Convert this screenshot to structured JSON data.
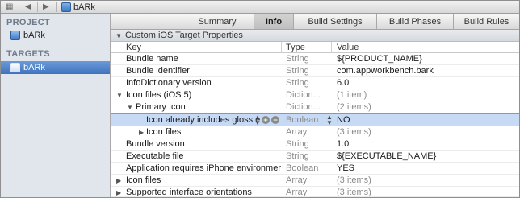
{
  "jumpbar": {
    "grid_icon": "grid-icon",
    "back_icon": "back-arrow-icon",
    "forward_icon": "forward-arrow-icon",
    "project_title": "bARk"
  },
  "sidebar": {
    "project_header": "PROJECT",
    "project_item": "bARk",
    "targets_header": "TARGETS",
    "target_item": "bARk"
  },
  "tabs": [
    "Summary",
    "Info",
    "Build Settings",
    "Build Phases",
    "Build Rules"
  ],
  "active_tab": "Info",
  "section": {
    "title": "Custom iOS Target Properties"
  },
  "table": {
    "headers": {
      "key": "Key",
      "type": "Type",
      "value": "Value"
    },
    "rows": [
      {
        "key": "Bundle name",
        "type": "String",
        "value": "${PRODUCT_NAME}"
      },
      {
        "key": "Bundle identifier",
        "type": "String",
        "value": "com.appworkbench.bark"
      },
      {
        "key": "InfoDictionary version",
        "type": "String",
        "value": "6.0"
      },
      {
        "key": "Icon files (iOS 5)",
        "type": "Diction...",
        "value": "(1 item)"
      },
      {
        "key": "Primary Icon",
        "type": "Diction...",
        "value": "(2 items)"
      },
      {
        "key": "Icon already includes gloss e",
        "type": "Boolean",
        "value": "NO"
      },
      {
        "key": "Icon files",
        "type": "Array",
        "value": "(3 items)"
      },
      {
        "key": "Bundle version",
        "type": "String",
        "value": "1.0"
      },
      {
        "key": "Executable file",
        "type": "String",
        "value": "${EXECUTABLE_NAME}"
      },
      {
        "key": "Application requires iPhone environmer",
        "type": "Boolean",
        "value": "YES"
      },
      {
        "key": "Icon files",
        "type": "Array",
        "value": "(3 items)"
      },
      {
        "key": "Supported interface orientations",
        "type": "Array",
        "value": "(3 items)"
      }
    ]
  }
}
